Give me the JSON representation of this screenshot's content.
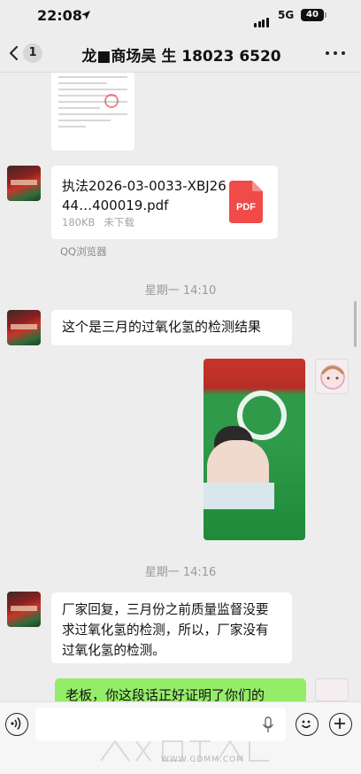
{
  "status_bar": {
    "time": "22:08",
    "network": "5G",
    "battery": "40"
  },
  "nav": {
    "unread_count": "1",
    "title": "龙■商场吴 生 18023 6520"
  },
  "messages": {
    "file": {
      "name": "执法2026-03-0033-XBJ2644…400019.pdf",
      "size": "180KB",
      "status": "未下载",
      "source": "QQ浏览器",
      "badge": "PDF"
    },
    "time_1": "星期一 14:10",
    "text_1": "这个是三月的过氧化氢的检测结果",
    "time_2": "星期一 14:16",
    "text_2": "厂家回复，三月份之前质量监督没要求过氧化氢的检测，所以，厂家没有过氧化氢的检测。",
    "text_3": "老板，你这段话正好证明了你们的"
  },
  "watermark": {
    "url": "WWW.GDMM.COM"
  },
  "colors": {
    "sent_bubble": "#95ec69",
    "background": "#ededed",
    "pdf": "#f04b48"
  }
}
